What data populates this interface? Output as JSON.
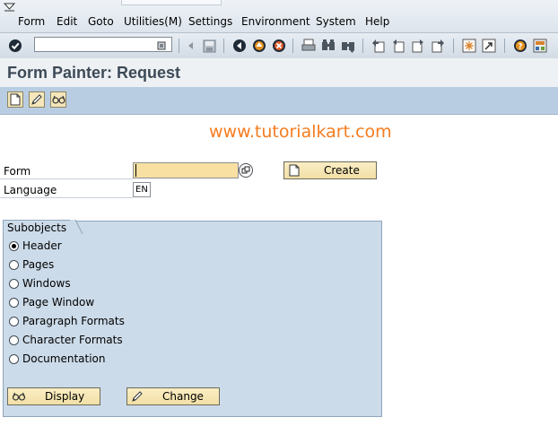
{
  "menu": {
    "items": [
      "Form",
      "Edit",
      "Goto",
      "Utilities(M)",
      "Settings",
      "Environment",
      "System",
      "Help"
    ]
  },
  "toolbar": {
    "command_field_value": "",
    "icons": [
      "enter-icon",
      "command-field-dropdown-icon",
      "back-icon",
      "save-icon",
      "green-back-icon",
      "exit-icon",
      "cancel-icon",
      "print-icon",
      "find-icon",
      "find-next-icon",
      "first-page-icon",
      "previous-page-icon",
      "next-page-icon",
      "last-page-icon",
      "create-session-icon",
      "shortcut-icon",
      "help-icon",
      "customize-layout-icon"
    ]
  },
  "header": {
    "title": "Form Painter: Request"
  },
  "app_toolbar": {
    "icons": [
      "create-icon",
      "change-icon",
      "display-icon"
    ]
  },
  "watermark": {
    "text": "www.tutorialkart.com"
  },
  "form": {
    "form_label": "Form",
    "form_value": "",
    "language_label": "Language",
    "language_value": "EN",
    "create_button": "Create"
  },
  "subobjects": {
    "title": "Subobjects",
    "options": [
      "Header",
      "Pages",
      "Windows",
      "Page Window",
      "Paragraph Formats",
      "Character Formats",
      "Documentation"
    ],
    "selected": "Header",
    "display_button": "Display",
    "change_button": "Change"
  },
  "colors": {
    "title_text": "#3d4a57",
    "app_toolbar_bg": "#b9cde2",
    "group_bg": "#ccdbe9",
    "required_field": "#f7e0a2",
    "button_bg": "#f1dfa6",
    "watermark": "#f57c1f"
  }
}
